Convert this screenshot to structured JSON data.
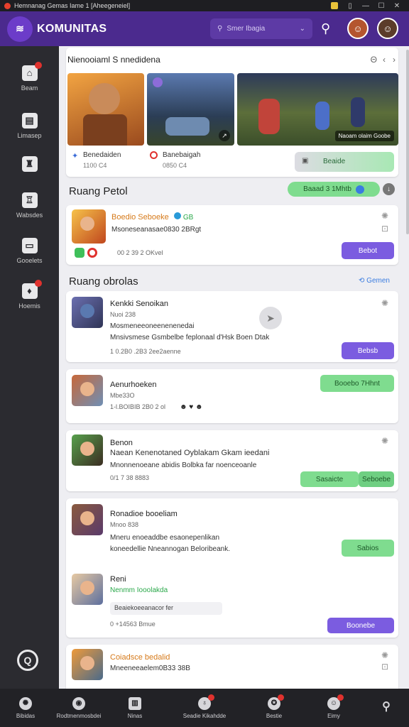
{
  "window": {
    "title": "Hemnanag Gemas Iame 1 [Aheegeneiel]"
  },
  "header": {
    "brand": "KOMUNITAS",
    "search_placeholder": "Smer Ibagia"
  },
  "sidebar": {
    "items": [
      {
        "label": "Beam",
        "icon": "home-icon"
      },
      {
        "label": "Limasep",
        "icon": "chat-icon"
      },
      {
        "label": "",
        "icon": "trophy-icon"
      },
      {
        "label": "Wabsdes",
        "icon": "tower-icon"
      },
      {
        "label": "Gooelets",
        "icon": "group-icon"
      },
      {
        "label": "Hoemis",
        "icon": "bell-icon"
      }
    ]
  },
  "highlight": {
    "title": "Nienooiaml S nnedidena",
    "games": [
      {
        "name": "Benedaiden",
        "meta": "1100 C4"
      },
      {
        "name": "Banebaigah",
        "meta": "0850 C4"
      }
    ],
    "tile_label": "Naoam olaim  Goobe",
    "action": "Beaide"
  },
  "ruang_petol": {
    "title": "Ruang Petol",
    "tag": "Baaad 3 1Mhtb",
    "post": {
      "name": "Boedio Seboeke",
      "badge": "GB",
      "line": "Msoneseanasae0830 2BRgt",
      "meta": "00 2 39 2 OKvel",
      "button": "Bebot"
    }
  },
  "ruang_obrolas": {
    "title": "Ruang obrolas",
    "link": "Gemen",
    "posts": [
      {
        "name": "Kenkki Senoikan",
        "sub": "Nuoi 238",
        "line1": "Mosmeneeoneenenenedai",
        "line2": "Mnsivsmese Gsmbelbe  feplonaal d'Hsk  Boen Dtak",
        "meta": "1 0.2B0 .2B3 2ee2aenne",
        "button": "Bebsb"
      },
      {
        "name": "Aenurhoeken",
        "sub": "Mbe33O",
        "meta": "1-l.BOIBIB 2B0 2 ol",
        "button": "Booebo 7Hhnt"
      },
      {
        "name": "Benon",
        "line1": "Naean Kenenotaned Oyblakam Gkam ieedani",
        "line2": "Mnonnenoeane abidis Bolbka  far noenceoanle",
        "meta": "0/1 7 38 8883",
        "button": "Sasaicte",
        "button2": "Seboebe"
      },
      {
        "name": "Ronadioe booeliam",
        "sub": "Mnoo 838",
        "line1": "Mneru enoeaddbe esaonepenlikan",
        "line2": "koneedellie  Nneannogan Beloribeank.",
        "button": "Sabios"
      },
      {
        "name": "Reni",
        "sub": "Nenmm Iooolakda",
        "line": "Beaiekoeeanacor fer",
        "meta": "0 +14563 Bmue",
        "button": "Boonebe"
      },
      {
        "name": "Coiadsce bedalid",
        "line": "Mneeneeaelem0B33 38B"
      }
    ]
  },
  "bottomnav": {
    "items": [
      {
        "label": "Bibidas",
        "icon": "gear-icon"
      },
      {
        "label": "Rodtmenmosbdei",
        "icon": "controller-icon"
      },
      {
        "label": "Ninas",
        "icon": "news-icon"
      },
      {
        "label": "Seadie Kikahdde",
        "icon": "cup-icon"
      },
      {
        "label": "Bestie",
        "icon": "shield-icon"
      },
      {
        "label": "Eimy",
        "icon": "profile-icon"
      },
      {
        "label": "",
        "icon": "search-icon"
      }
    ]
  },
  "colors": {
    "header": "#4b2a8e",
    "accent_purple": "#7b5ce0",
    "accent_green": "#7fdc8f"
  }
}
